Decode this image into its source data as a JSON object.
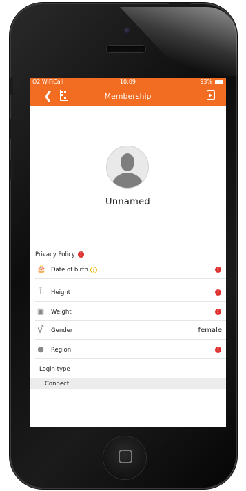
{
  "status_bar": {
    "carrier": "O2 WiFiCall",
    "time": "10:09",
    "battery": "93%"
  },
  "nav": {
    "title": "Membership",
    "back_icon": "chevron-left-icon",
    "qr_icon": "qr-code-icon",
    "exit_icon": "exit-icon"
  },
  "profile": {
    "name": "Unnamed"
  },
  "privacy": {
    "title": "Privacy Policy",
    "alert_glyph": "!"
  },
  "fields": [
    {
      "label": "Date of birth",
      "icon": "cake-icon",
      "glyph": "🎂",
      "has_info": true,
      "info_glyph": "i",
      "value": "",
      "alert": true
    },
    {
      "label": "Height",
      "icon": "height-icon",
      "glyph": "Ī",
      "has_info": false,
      "value": "",
      "alert": true
    },
    {
      "label": "Weight",
      "icon": "scale-icon",
      "glyph": "▣",
      "has_info": false,
      "value": "",
      "alert": true
    },
    {
      "label": "Gender",
      "icon": "gender-icon",
      "glyph": "⚥",
      "has_info": false,
      "value": "female",
      "alert": false
    },
    {
      "label": "Region",
      "icon": "location-pin-icon",
      "glyph": "●",
      "has_info": false,
      "value": "",
      "alert": true
    }
  ],
  "login": {
    "title": "Login type",
    "connect_label": "Connect"
  },
  "colors": {
    "accent": "#f26d22",
    "alert": "#e03030",
    "info": "#f4b400"
  }
}
